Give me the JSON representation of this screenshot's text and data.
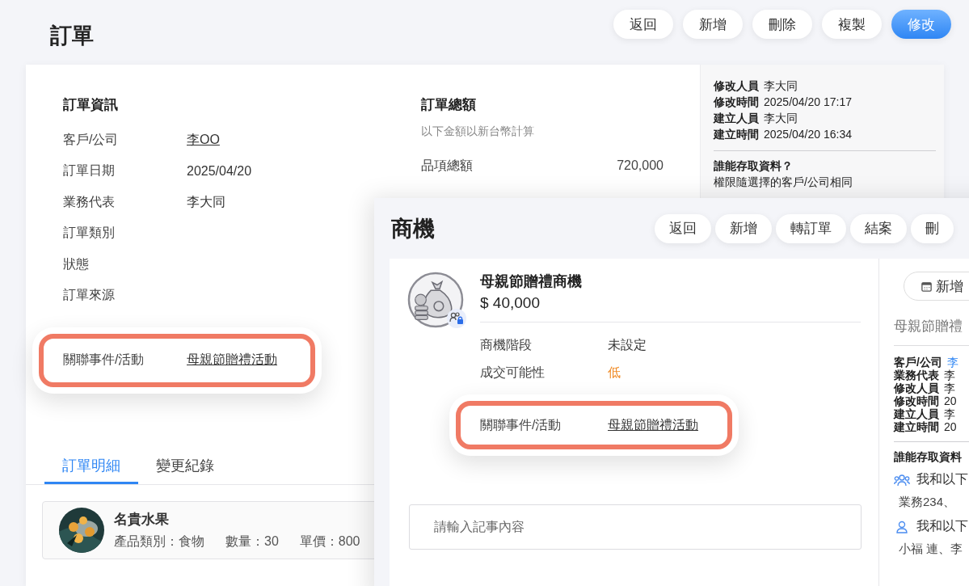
{
  "order_page": {
    "title": "訂單",
    "actions": [
      {
        "label": "返回",
        "primary": false
      },
      {
        "label": "新增",
        "primary": false
      },
      {
        "label": "刪除",
        "primary": false
      },
      {
        "label": "複製",
        "primary": false
      },
      {
        "label": "修改",
        "primary": true
      }
    ],
    "info": {
      "heading": "訂單資訊",
      "fields": [
        {
          "label": "客戶/公司",
          "value": "李OO",
          "link": true,
          "highlighted": false
        },
        {
          "label": "訂單日期",
          "value": "2025/04/20",
          "link": false,
          "highlighted": false
        },
        {
          "label": "業務代表",
          "value": "李大同",
          "link": false,
          "highlighted": false
        },
        {
          "label": "訂單類別",
          "highlighted": false
        },
        {
          "label": "狀態",
          "highlighted": false
        },
        {
          "label": "訂單來源",
          "highlighted": false
        },
        {
          "label": "關聯事件/活動",
          "value": "母親節贈禮活動",
          "link": true,
          "highlighted": true
        }
      ]
    },
    "totals": {
      "heading": "訂單總額",
      "note": "以下金額以新台幣計算",
      "rows": [
        {
          "label": "品項總額",
          "value": "720,000"
        }
      ]
    },
    "record": {
      "fields": [
        {
          "label": "修改人員",
          "value": "李大同"
        },
        {
          "label": "修改時間",
          "value": "2025/04/20 17:17"
        },
        {
          "label": "建立人員",
          "value": "李大同"
        },
        {
          "label": "建立時間",
          "value": "2025/04/20 16:34"
        }
      ],
      "access_heading": "誰能存取資料？",
      "access_note": "權限隨選擇的客戶/公司相同"
    },
    "tabs": [
      {
        "label": "訂單明細",
        "selected": true
      },
      {
        "label": "變更紀錄",
        "selected": false
      }
    ],
    "items": [
      {
        "name": "名貴水果",
        "details": [
          "產品類別：食物",
          "數量：30",
          "單價：800"
        ]
      }
    ]
  },
  "opportunity_window": {
    "title": "商機",
    "actions": [
      "返回",
      "新增",
      "轉訂單",
      "結案",
      "刪"
    ],
    "name": "母親節贈禮商機",
    "amount": "$ 40,000",
    "fields": [
      {
        "label": "商機階段",
        "value": "未設定",
        "link": false,
        "highlighted": false
      },
      {
        "label": "成交可能性",
        "value": "低",
        "color": "#f08a24",
        "link": false,
        "highlighted": false
      },
      {
        "label": "關聯事件/活動",
        "value": "母親節贈禮活動",
        "link": true,
        "highlighted": true
      }
    ],
    "memo": {
      "placeholder": "請輸入記事內容"
    },
    "side": {
      "button": "新增",
      "subtitle": "母親節贈禮",
      "fields": [
        {
          "label": "客戶/公司",
          "value": "李",
          "link": true
        },
        {
          "label": "業務代表",
          "value": "李",
          "link": false
        },
        {
          "label": "修改人員",
          "value": "李",
          "link": false
        },
        {
          "label": "修改時間",
          "value": "20",
          "link": false
        },
        {
          "label": "建立人員",
          "value": "李",
          "link": false
        },
        {
          "label": "建立時間",
          "value": "20",
          "link": false
        }
      ],
      "access_heading": "誰能存取資料",
      "access": [
        {
          "kind": "group",
          "label": "我和以下",
          "members": "業務234、"
        },
        {
          "kind": "person",
          "label": "我和以下",
          "members": "小福 連、李"
        }
      ]
    }
  }
}
